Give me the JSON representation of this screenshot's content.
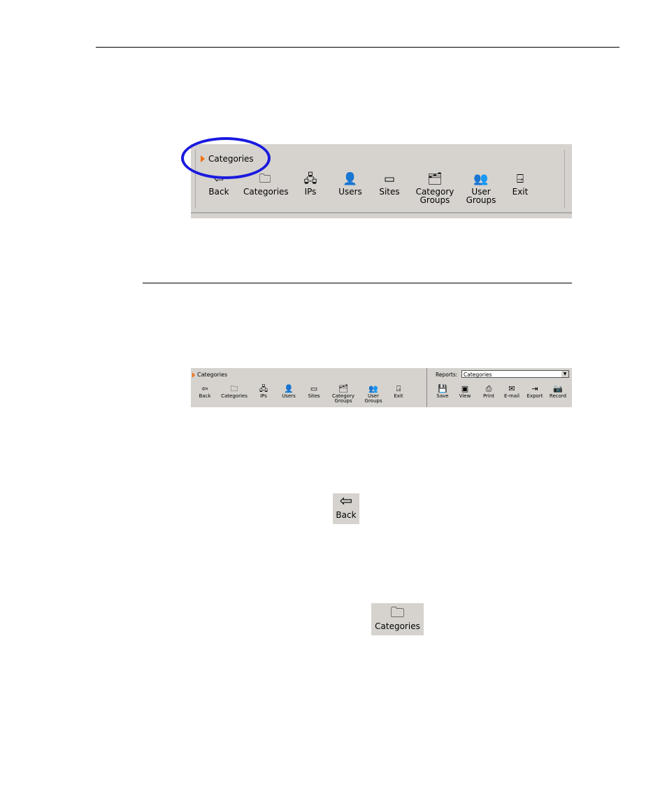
{
  "nav_buttons": [
    {
      "label": "Back",
      "icon": "back-arrow-icon",
      "glyph": "⇦"
    },
    {
      "label": "Categories",
      "icon": "folders-icon",
      "glyph": "🗀"
    },
    {
      "label": "IPs",
      "icon": "computers-icon",
      "glyph": "🖧"
    },
    {
      "label": "Users",
      "icon": "user-icon",
      "glyph": "👤"
    },
    {
      "label": "Sites",
      "icon": "window-icon",
      "glyph": "▭"
    },
    {
      "label": "Category Groups",
      "icon": "folder-group-icon",
      "glyph": "🗂"
    },
    {
      "label": "User Groups",
      "icon": "users-icon",
      "glyph": "👥"
    },
    {
      "label": "Exit",
      "icon": "exit-door-icon",
      "glyph": "⍈"
    }
  ],
  "breadcrumb": "Categories",
  "reports": {
    "label": "Reports:",
    "selected": "Categories",
    "buttons": [
      {
        "label": "Save",
        "icon": "floppy-icon",
        "glyph": "💾"
      },
      {
        "label": "View",
        "icon": "monitor-icon",
        "glyph": "▣"
      },
      {
        "label": "Print",
        "icon": "printer-icon",
        "glyph": "⎙"
      },
      {
        "label": "E-mail",
        "icon": "mail-icon",
        "glyph": "✉"
      },
      {
        "label": "Export",
        "icon": "export-icon",
        "glyph": "⇥"
      },
      {
        "label": "Record",
        "icon": "camera-icon",
        "glyph": "📷"
      }
    ]
  },
  "highlight_color": "#1a1adf",
  "toolbar_color": "#d6d3ce"
}
